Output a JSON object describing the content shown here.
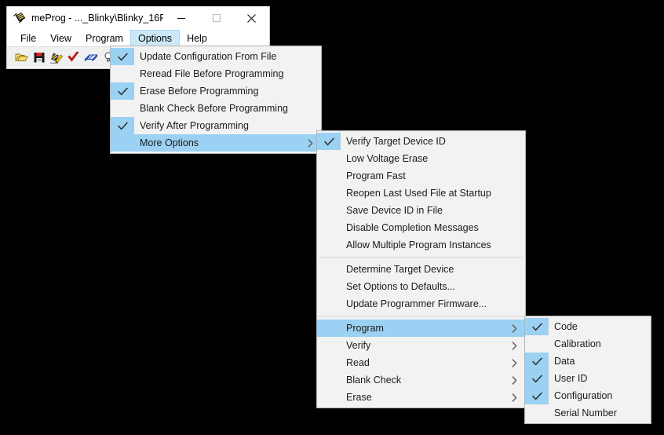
{
  "window": {
    "title": "meProg - ..._Blinky\\Blinky_16F...",
    "icon": "chip-icon",
    "caption": {
      "minimize": "minimize-icon",
      "maximize": "maximize-icon",
      "close": "close-icon"
    }
  },
  "menubar": {
    "items": [
      {
        "label": "File",
        "active": false
      },
      {
        "label": "View",
        "active": false
      },
      {
        "label": "Program",
        "active": false
      },
      {
        "label": "Options",
        "active": true
      },
      {
        "label": "Help",
        "active": false
      }
    ]
  },
  "toolbar": {
    "buttons": [
      {
        "name": "open-file-icon",
        "tip": "Open File"
      },
      {
        "name": "save-file-icon",
        "tip": "Save File"
      },
      {
        "name": "program-device-icon",
        "tip": "Program Device"
      },
      {
        "name": "verify-device-icon",
        "tip": "Verify Device"
      },
      {
        "name": "read-device-icon",
        "tip": "Read Device"
      },
      {
        "name": "blank-check-icon",
        "tip": "Blank Check"
      }
    ]
  },
  "menus": {
    "options": {
      "name": "options-menu",
      "items": [
        {
          "label": "Update Configuration From File",
          "checked": true,
          "highlight": false,
          "submenu": false
        },
        {
          "label": "Reread File Before Programming",
          "checked": false,
          "highlight": false,
          "submenu": false
        },
        {
          "label": "Erase Before Programming",
          "checked": true,
          "highlight": false,
          "submenu": false
        },
        {
          "label": "Blank Check Before Programming",
          "checked": false,
          "highlight": false,
          "submenu": false
        },
        {
          "label": "Verify After Programming",
          "checked": true,
          "highlight": false,
          "submenu": false
        },
        {
          "label": "More Options",
          "checked": false,
          "highlight": true,
          "submenu": true
        }
      ]
    },
    "more_options": {
      "name": "more-options-submenu",
      "items": [
        {
          "label": "Verify Target Device ID",
          "checked": true,
          "highlight": false,
          "submenu": false,
          "separator_after": false
        },
        {
          "label": "Low Voltage Erase",
          "checked": false,
          "highlight": false,
          "submenu": false,
          "separator_after": false
        },
        {
          "label": "Program Fast",
          "checked": false,
          "highlight": false,
          "submenu": false,
          "separator_after": false
        },
        {
          "label": "Reopen Last Used File at Startup",
          "checked": false,
          "highlight": false,
          "submenu": false,
          "separator_after": false
        },
        {
          "label": "Save Device ID in File",
          "checked": false,
          "highlight": false,
          "submenu": false,
          "separator_after": false
        },
        {
          "label": "Disable Completion Messages",
          "checked": false,
          "highlight": false,
          "submenu": false,
          "separator_after": false
        },
        {
          "label": "Allow Multiple Program Instances",
          "checked": false,
          "highlight": false,
          "submenu": false,
          "separator_after": true
        },
        {
          "label": "Determine Target Device",
          "checked": false,
          "highlight": false,
          "submenu": false,
          "separator_after": false
        },
        {
          "label": "Set Options to Defaults...",
          "checked": false,
          "highlight": false,
          "submenu": false,
          "separator_after": false
        },
        {
          "label": "Update Programmer Firmware...",
          "checked": false,
          "highlight": false,
          "submenu": false,
          "separator_after": true
        },
        {
          "label": "Program",
          "checked": false,
          "highlight": true,
          "submenu": true,
          "separator_after": false
        },
        {
          "label": "Verify",
          "checked": false,
          "highlight": false,
          "submenu": true,
          "separator_after": false
        },
        {
          "label": "Read",
          "checked": false,
          "highlight": false,
          "submenu": true,
          "separator_after": false
        },
        {
          "label": "Blank Check",
          "checked": false,
          "highlight": false,
          "submenu": true,
          "separator_after": false
        },
        {
          "label": "Erase",
          "checked": false,
          "highlight": false,
          "submenu": true,
          "separator_after": false
        }
      ]
    },
    "program": {
      "name": "program-submenu",
      "items": [
        {
          "label": "Code",
          "checked": true,
          "highlight": false,
          "submenu": false
        },
        {
          "label": "Calibration",
          "checked": false,
          "highlight": false,
          "submenu": false
        },
        {
          "label": "Data",
          "checked": true,
          "highlight": false,
          "submenu": false
        },
        {
          "label": "User ID",
          "checked": true,
          "highlight": false,
          "submenu": false
        },
        {
          "label": "Configuration",
          "checked": true,
          "highlight": false,
          "submenu": false
        },
        {
          "label": "Serial Number",
          "checked": false,
          "highlight": false,
          "submenu": false
        }
      ]
    }
  },
  "colors": {
    "highlight": "#9bd1f2",
    "menu_bg": "#f2f2f2",
    "menubar_active": "#cce8f7",
    "toolbar_bg": "#f0f0f0",
    "desktop": "#000000",
    "text": "#1b1b1b"
  }
}
